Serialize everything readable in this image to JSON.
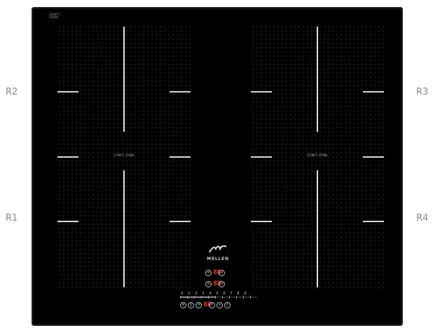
{
  "labels": {
    "r1": "R1",
    "r2": "R2",
    "r3": "R3",
    "r4": "R4"
  },
  "brand_tag": {
    "line1": "SCHOTT",
    "line2": "CERAN"
  },
  "comfy_zone": {
    "left": "COMFY ZONE",
    "right": "COMFY ZONE"
  },
  "logo_text": "MELLEN",
  "displays": {
    "rear": "88",
    "front": "88",
    "timer": "88"
  },
  "power_levels": [
    "0",
    "1",
    "2",
    "3",
    "4",
    "5",
    "6",
    "7",
    "8",
    "9"
  ],
  "power_level_fraction": 0.45,
  "icons": {
    "rear_left": "left-zone-rear-icon",
    "rear_right": "right-zone-rear-icon",
    "front_left": "left-zone-front-icon",
    "front_right": "right-zone-front-icon",
    "lock": "lock-icon",
    "pause": "pause-icon",
    "timer": "timer-icon",
    "boost": "boost-icon",
    "hold": "keep-warm-icon",
    "power": "power-icon"
  },
  "colors": {
    "surface": "#000000",
    "display": "#ff3b1f",
    "marks": "#e0e0e0"
  }
}
